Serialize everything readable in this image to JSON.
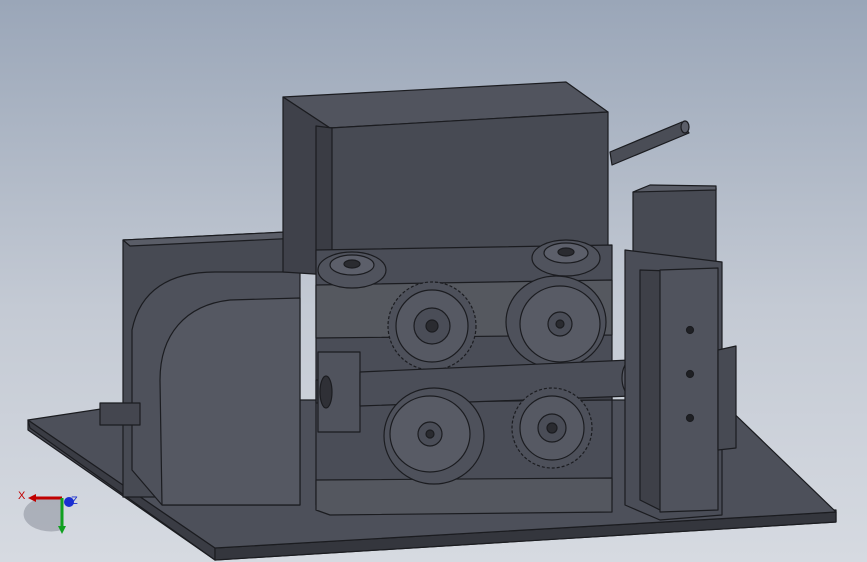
{
  "viewport": {
    "background_top": "#9aa6b8",
    "background_bottom": "#d6dae1",
    "model_color": "#4b4e58",
    "model_shadow": "#3a3c44",
    "edge_color": "#1b1c20"
  },
  "triad": {
    "x_label": "X",
    "y_label": "",
    "z_label": "Z",
    "x_color": "#c00000",
    "y_color": "#10a020",
    "z_color": "#1a2fd1"
  }
}
